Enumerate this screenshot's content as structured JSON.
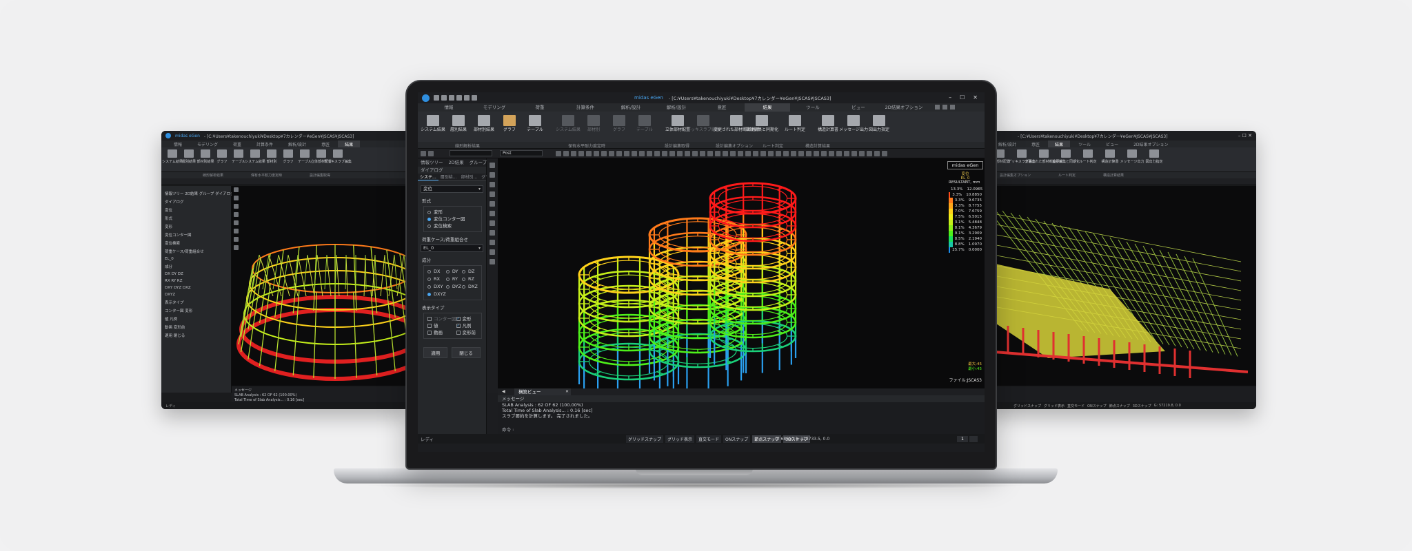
{
  "main": {
    "app_name": "midas eGen",
    "path": "- [C:¥Users¥takenouchiyuki¥Desktop¥7カレンダー¥eGen¥JSCAS¥JSCAS3]",
    "menu": [
      "情報",
      "モデリング",
      "荷重",
      "計算条件",
      "解析/設計",
      "解析/設計",
      "意匠",
      "結果",
      "ツール",
      "ビュー",
      "2D結果オプション"
    ],
    "ribbon": [
      {
        "label": "システム結果",
        "state": "on"
      },
      {
        "label": "層別結果",
        "state": "on"
      },
      {
        "label": "部材別結果",
        "state": "on"
      },
      {
        "label": "グラフ",
        "state": "hi"
      },
      {
        "label": "テーブル",
        "state": "on"
      },
      {
        "label": "システム結果",
        "state": "dim"
      },
      {
        "label": "部材別",
        "state": "dim"
      },
      {
        "label": "グラフ",
        "state": "dim"
      },
      {
        "label": "テーブル",
        "state": "dim"
      },
      {
        "label": "立体部材配置",
        "state": "on"
      },
      {
        "label": "デッキスラブ編集",
        "state": "dim"
      },
      {
        "label": "変更された部材断面更新",
        "state": "on"
      },
      {
        "label": "設計編集と同期化",
        "state": "on"
      },
      {
        "label": "ルート判定",
        "state": "on"
      },
      {
        "label": "構造計算書",
        "state": "on"
      },
      {
        "label": "メッセージ出力",
        "state": "on"
      },
      {
        "label": "図出力指定",
        "state": "on"
      }
    ],
    "ribbon_groups": [
      "線形解析結果",
      "保有水平耐力度定時",
      "設計編集取得",
      "設計編集オプション",
      "ルート判定",
      "構造計算結果"
    ],
    "toolbar_dropdown_1": "",
    "toolbar_dropdown_2": "Post",
    "panel": {
      "tabs": [
        "情報ツリー",
        "2D結果",
        "グループ",
        "ダイアログ"
      ],
      "subtabs": [
        "システ...",
        "層別結...",
        "部材別...",
        "グラフ結..."
      ],
      "dialog_title": "ダイアログ",
      "result_type": "変位",
      "format_label": "形式",
      "format_options": [
        "変形",
        "変位コンター図",
        "変位検索"
      ],
      "loadcase_label": "荷重ケース/荷重組合せ",
      "loadcase_value": "EL_0",
      "component_label": "成分",
      "components": [
        "DX",
        "DY",
        "DZ",
        "RX",
        "RY",
        "RZ",
        "DXY",
        "DYZ",
        "DXZ",
        "DXYZ"
      ],
      "display_label": "表示タイプ",
      "display_options": [
        {
          "label": "コンター図",
          "checked": false,
          "dim": true
        },
        {
          "label": "変形",
          "checked": true,
          "dim": false
        },
        {
          "label": "値",
          "checked": false,
          "dim": false
        },
        {
          "label": "凡例",
          "checked": true,
          "dim": false
        },
        {
          "label": "動画",
          "checked": false,
          "dim": false
        },
        {
          "label": "変形前",
          "checked": false,
          "dim": false
        }
      ],
      "apply_button": "適用",
      "close_button": "閉じる"
    },
    "viewport": {
      "logo": "midas eGen",
      "legend_title": "RESULTANT, mm",
      "legend_sub1": "変位",
      "legend_sub2": "EL_0",
      "legend_rows": [
        {
          "pct": "13.3%",
          "value": "12.0965",
          "color": "#ff1a1a"
        },
        {
          "pct": "3.3%",
          "value": "10.8850",
          "color": "#ff4a1a"
        },
        {
          "pct": "3.3%",
          "value": "9.6735",
          "color": "#ff7a1a"
        },
        {
          "pct": "3.3%",
          "value": "8.7755",
          "color": "#ffa61a"
        },
        {
          "pct": "7.0%",
          "value": "7.6759",
          "color": "#ffd21a"
        },
        {
          "pct": "7.5%",
          "value": "6.5015",
          "color": "#f0f01a"
        },
        {
          "pct": "3.1%",
          "value": "5.4848",
          "color": "#c6f01a"
        },
        {
          "pct": "8.1%",
          "value": "4.3679",
          "color": "#8ef01a"
        },
        {
          "pct": "9.1%",
          "value": "3.2909",
          "color": "#4ef01a"
        },
        {
          "pct": "8.5%",
          "value": "2.1940",
          "color": "#1ae05a"
        },
        {
          "pct": "8.8%",
          "value": "1.0970",
          "color": "#1ac6a6"
        },
        {
          "pct": "25.7%",
          "value": "0.0000",
          "color": "#1a8ef0"
        }
      ],
      "max_label": "最大:45",
      "min_label": "最小:45",
      "file_label": "ファイル:JSCAS3"
    },
    "view_tab": "構築ビュー",
    "messages": {
      "header": "メッセージ",
      "lines": [
        "SLAB Analysis : 62 OF 62 (100.00%)",
        "Total Time of Slab Analysis... : 0.16 [sec]",
        "スラブ要約を計算します。 完了されました。"
      ],
      "command": "命令 :"
    },
    "status": {
      "ready": "レディ",
      "snaps": [
        {
          "label": "グリッドスナップ",
          "on": false
        },
        {
          "label": "グリッド表示",
          "on": false
        },
        {
          "label": "直交モード",
          "on": false
        },
        {
          "label": "ONスナップ",
          "on": false
        },
        {
          "label": "節点スナップ",
          "on": true
        },
        {
          "label": "3Dスナップ",
          "on": true
        }
      ],
      "coord": "G: 68610.1, 125733.5, 0.0",
      "page_left": "1",
      "page_right": ""
    }
  },
  "left_screen": {
    "app_name": "midas eGen",
    "path": "- [C:¥Users¥takenouchiyuki¥Desktop¥7カレンダー¥eGen¥JSCAS¥JSCAS3]",
    "tabs": [
      "情報",
      "モデリング",
      "荷重",
      "計算条件",
      "解析/設計",
      "意匠",
      "結果"
    ],
    "ribbon": [
      "システム結果",
      "層別結果",
      "部材別結果",
      "グラフ",
      "テーブル",
      "システム結果",
      "部材別",
      "グラフ",
      "テーブル",
      "立体部材配置",
      "デッキスラブ編集"
    ],
    "groups": [
      "線形解析結果",
      "保有水平耐力度定時",
      "設計編集取得"
    ],
    "panel_lines": [
      "情報ツリー  2D結果  グループ  ダイアログ",
      "ダイアログ",
      "変位",
      "形式",
      "変形",
      "変位コンター図",
      "変位検索",
      "荷重ケース/荷重組合せ",
      "EL_0",
      "成分",
      "DX   DY   DZ",
      "RX   RY   RZ",
      "DXY  DYZ  DXZ",
      "DXYZ",
      "表示タイプ",
      "コンター図   変形",
      "値   凡例",
      "動画   変形前",
      "適用   閉じる"
    ],
    "view_tab": "構築ビュー",
    "messages": [
      "メッセージ",
      "SLAB Analysis : 62 OF 62 (100.00%)",
      "Total Time of Slab Analysis... : 0.16 [sec]",
      "スラブ要約を計算します。 完了されました。"
    ],
    "status": "レディ"
  },
  "right_screen": {
    "path": "- [C:¥Users¥takenouchiyuki¥Desktop¥7カレンダー¥eGen¥JSCAS¥JSCAS3]",
    "tabs": [
      "解析/設計",
      "意匠",
      "結果",
      "ツール",
      "ビュー",
      "2D結果オプション"
    ],
    "ribbon": [
      "立体部材配置",
      "デッキスラブ編集",
      "変更された部材断面更新",
      "設計編集と同期化",
      "ルート判定",
      "構造計算書",
      "メッセージ出力",
      "図出力指定"
    ],
    "groups": [
      "設計編集オプション",
      "ルート判定",
      "構造計算結果"
    ],
    "status": [
      "グリッドスナップ",
      "グリッド表示",
      "直交モード",
      "ONスナップ",
      "節点スナップ",
      "3Dスナップ",
      "G: 57219.8, 0.0"
    ]
  }
}
